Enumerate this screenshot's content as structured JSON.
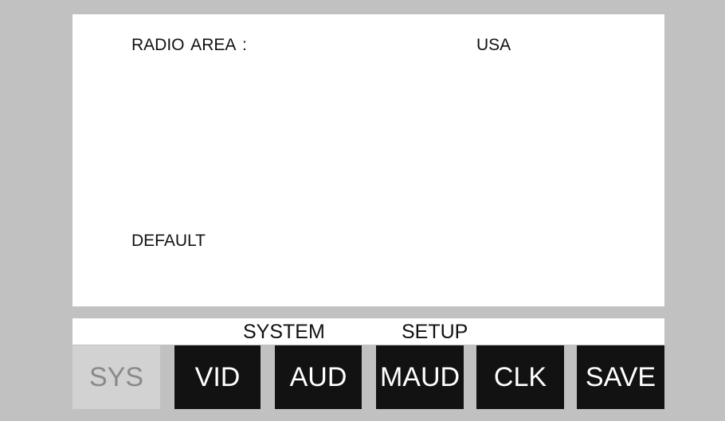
{
  "screen": {
    "radio_area_label": "RADIO AREA :",
    "radio_area_value": "USA",
    "default_option": "DEFAULT"
  },
  "title_bar": {
    "word1": "SYSTEM",
    "word2": "SETUP"
  },
  "tabs": [
    {
      "label": "SYS",
      "active": true
    },
    {
      "label": "VID",
      "active": false
    },
    {
      "label": "AUD",
      "active": false
    },
    {
      "label": "MAUD",
      "active": false
    },
    {
      "label": "CLK",
      "active": false
    },
    {
      "label": "SAVE",
      "active": false
    }
  ],
  "colors": {
    "background": "#c1c1c1",
    "panel": "#ffffff",
    "tab_inactive": "#121212",
    "tab_active": "#d2d2d2",
    "tab_active_text": "#8a8a8a"
  }
}
